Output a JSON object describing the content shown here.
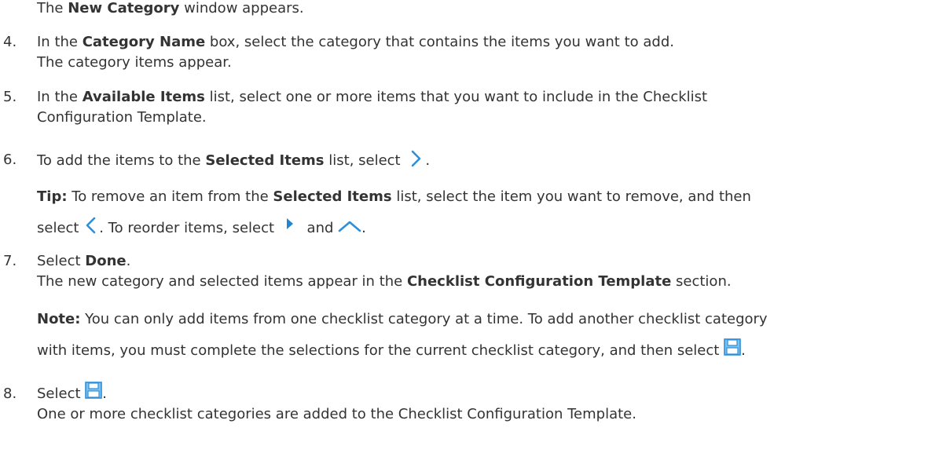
{
  "intro": {
    "p1": "The ",
    "b1": "New Category",
    "p2": " window appears."
  },
  "steps": [
    {
      "num": "4.",
      "p1": "In the ",
      "b1": "Category Name",
      "p2": " box, select the category that contains the items you want to add.",
      "result": "The category items appear."
    },
    {
      "num": "5.",
      "p1": "In the ",
      "b1": "Available Items",
      "p2": " list, select one or more items that you want to include in the Checklist",
      "p3": "Configuration Template."
    },
    {
      "num": "6.",
      "p1": "To add the items to the ",
      "b1": "Selected Items",
      "p2": " list, select ",
      "p3": ".",
      "tip_label": "Tip:",
      "tip_p1": " To remove an item from the ",
      "tip_b1": "Selected Items",
      "tip_p2": " list, select the item you want to remove, and then",
      "tip_p3": "select ",
      "tip_p4": ". To reorder items, select ",
      "tip_p5": " and ",
      "tip_p6": "."
    },
    {
      "num": "7.",
      "p1": "Select ",
      "b1": "Done",
      "p2": ".",
      "result_p1": "The new category and selected items appear in the ",
      "result_b1": "Checklist Configuration Template",
      "result_p2": " section.",
      "note_label": "Note:",
      "note_p1": " You can only add items from one checklist category at a time. To add another checklist category",
      "note_p2": "with items, you must complete the selections for the current checklist category, and then select ",
      "note_p3": "."
    },
    {
      "num": "8.",
      "p1": "Select ",
      "p2": ".",
      "result": "One or more checklist categories are added to the Checklist Configuration Template."
    }
  ],
  "icons": {
    "add_icon": "chevron-right-icon",
    "remove_icon": "chevron-left-icon",
    "reorder_icon_1": "caret-right-icon",
    "reorder_icon_2": "chevron-up-icon",
    "save_icon": "save-icon"
  },
  "colors": {
    "text": "#333333",
    "icon_blue": "#2f8fd8",
    "save_fill": "#7cc4ef"
  }
}
